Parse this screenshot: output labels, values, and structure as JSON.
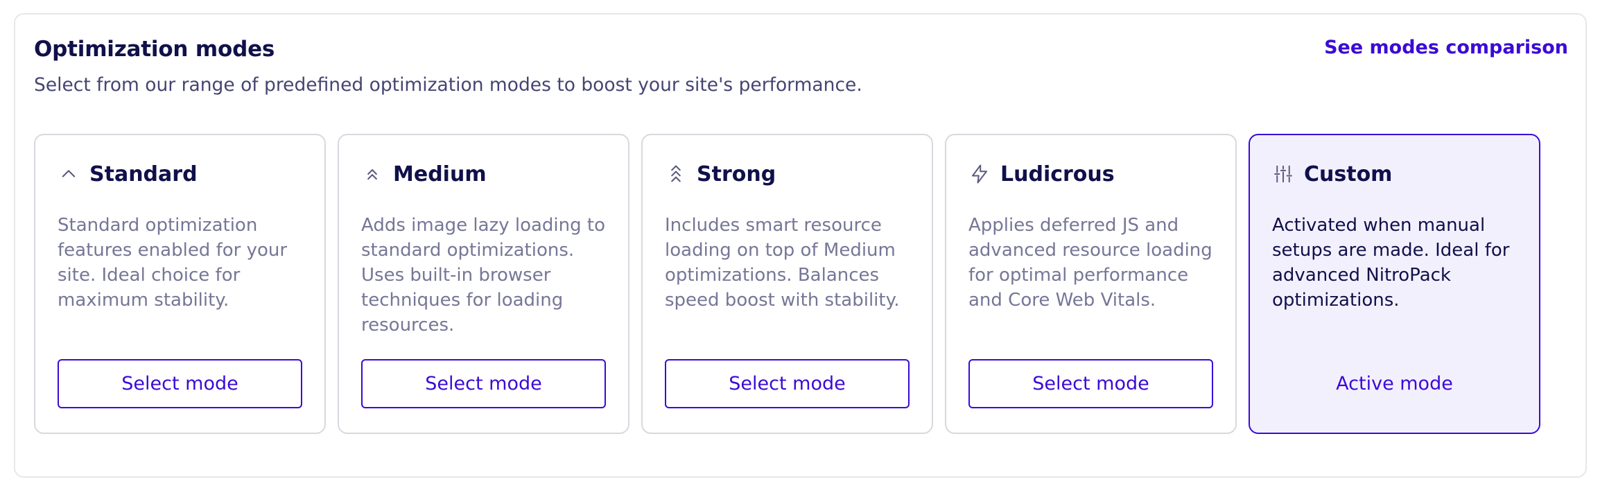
{
  "section": {
    "title": "Optimization modes",
    "subtitle": "Select from our range of predefined optimization modes to boost your site's performance.",
    "compare_link": "See modes comparison"
  },
  "colors": {
    "accent": "#3b0ad6",
    "heading": "#10104a",
    "muted_text": "#767697",
    "active_card_bg": "#f3f0fe",
    "card_border": "#d8d8df"
  },
  "modes": [
    {
      "name": "Standard",
      "icon": "chevron-up-icon",
      "description": "Standard optimization features enabled for your site. Ideal choice for maximum stability.",
      "button": "Select mode",
      "active": false
    },
    {
      "name": "Medium",
      "icon": "double-chevron-up-icon",
      "description": "Adds image lazy loading to standard optimizations. Uses built-in browser techniques for loading resources.",
      "button": "Select mode",
      "active": false
    },
    {
      "name": "Strong",
      "icon": "triple-chevron-up-icon",
      "description": "Includes smart resource loading on top of Medium optimizations. Balances speed boost with stability.",
      "button": "Select mode",
      "active": false
    },
    {
      "name": "Ludicrous",
      "icon": "lightning-bolt-icon",
      "description": "Applies deferred JS and advanced resource loading for optimal performance and Core Web Vitals.",
      "button": "Select mode",
      "active": false
    },
    {
      "name": "Custom",
      "icon": "sliders-icon",
      "description": "Activated when manual setups are made. Ideal for advanced NitroPack optimizations.",
      "button": "Active mode",
      "active": true
    }
  ]
}
